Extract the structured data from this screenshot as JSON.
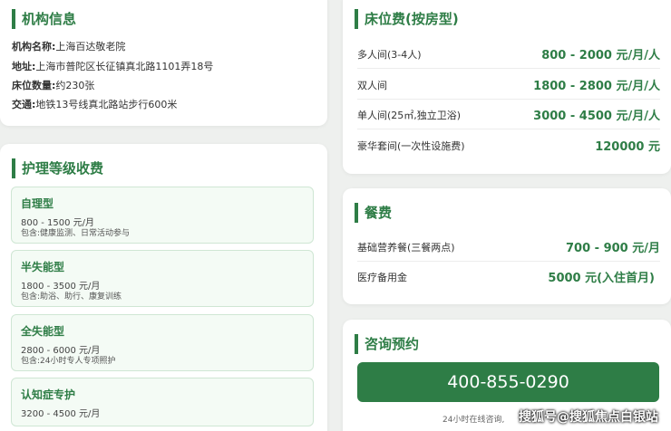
{
  "institution": {
    "title": "机构信息",
    "items": [
      {
        "key": "机构名称:",
        "value": "上海百达敬老院"
      },
      {
        "key": "地址:",
        "value": "上海市普陀区长征镇真北路1101弄18号"
      },
      {
        "key": "床位数量:",
        "value": "约230张"
      },
      {
        "key": "交通:",
        "value": "地铁13号线真北路站步行600米"
      }
    ]
  },
  "care_levels": {
    "title": "护理等级收费",
    "levels": [
      {
        "name": "自理型",
        "price": "800 - 1500 元/月",
        "includes": "包含:健康监测、日常活动参与"
      },
      {
        "name": "半失能型",
        "price": "1800 - 3500 元/月",
        "includes": "包含:助浴、助行、康复训练"
      },
      {
        "name": "全失能型",
        "price": "2800 - 6000 元/月",
        "includes": "包含:24小时专人专项照护"
      },
      {
        "name": "认知症专护",
        "price": "3200 - 4500 元/月",
        "includes": ""
      }
    ]
  },
  "beds": {
    "title": "床位费(按房型)",
    "rows": [
      {
        "label": "多人间(3-4人)",
        "value": "800 - 2000 元/月/人"
      },
      {
        "label": "双人间",
        "value": "1800 - 2800 元/月/人"
      },
      {
        "label": "单人间(25㎡,独立卫浴)",
        "value": "3000 - 4500 元/月/人"
      },
      {
        "label": "豪华套间(一次性设施费)",
        "value": "120000 元"
      }
    ]
  },
  "meals": {
    "title": "餐费",
    "rows": [
      {
        "label": "基础营养餐(三餐两点)",
        "value": "700 - 900 元/月"
      },
      {
        "label": "医疗备用金",
        "value": "5000 元(入住首月)"
      }
    ]
  },
  "consult": {
    "title": "咨询预约",
    "phone": "400-855-0290",
    "note": "24小时在线咨询,"
  },
  "watermark": "搜狐号@搜狐焦点白银站",
  "colors": {
    "accent": "#2e7d46",
    "card_bg": "#ffffff",
    "page_bg": "#eef0ee",
    "level_bg": "#f4fbf5"
  }
}
